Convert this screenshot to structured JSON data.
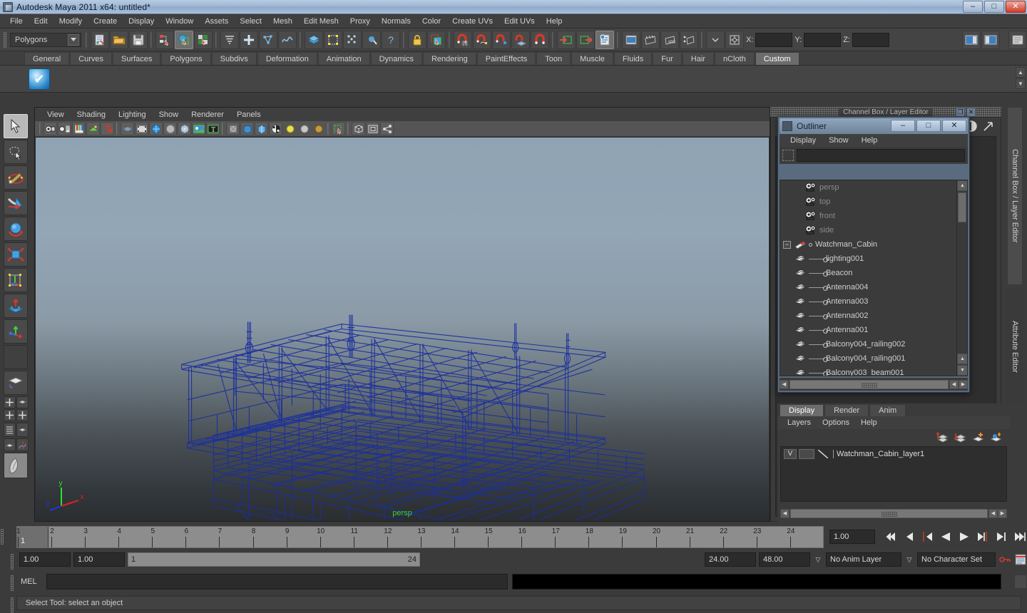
{
  "window": {
    "title": "Autodesk Maya 2011 x64: untitled*",
    "buttons": {
      "minimize": "–",
      "maximize": "□",
      "close": "✕"
    }
  },
  "menubar": {
    "items": [
      "File",
      "Edit",
      "Modify",
      "Create",
      "Display",
      "Window",
      "Assets",
      "Select",
      "Mesh",
      "Edit Mesh",
      "Proxy",
      "Normals",
      "Color",
      "Create UVs",
      "Edit UVs",
      "Help"
    ]
  },
  "statusline": {
    "selection_mode": "Polygons",
    "coords": {
      "x_label": "X:",
      "y_label": "Y:",
      "z_label": "Z:",
      "x_value": "",
      "y_value": "",
      "z_value": ""
    }
  },
  "shelf": {
    "tabs": [
      "General",
      "Curves",
      "Surfaces",
      "Polygons",
      "Subdivs",
      "Deformation",
      "Animation",
      "Dynamics",
      "Rendering",
      "PaintEffects",
      "Toon",
      "Muscle",
      "Fluids",
      "Fur",
      "Hair",
      "nCloth",
      "Custom"
    ],
    "selected_tab": "Custom",
    "items": [
      "check-mark-shelf-icon"
    ]
  },
  "viewport": {
    "menus": [
      "View",
      "Shading",
      "Lighting",
      "Show",
      "Renderer",
      "Panels"
    ],
    "camera_label": "persp",
    "axis": {
      "x": "x",
      "y": "y",
      "z": "z"
    }
  },
  "outliner": {
    "title": "Outliner",
    "window_buttons": {
      "minimize": "–",
      "maximize": "□",
      "close": "✕"
    },
    "menus": [
      "Display",
      "Show",
      "Help"
    ],
    "filter_value": "",
    "items": [
      {
        "label": "persp",
        "type": "camera"
      },
      {
        "label": "top",
        "type": "camera"
      },
      {
        "label": "front",
        "type": "camera"
      },
      {
        "label": "side",
        "type": "camera"
      },
      {
        "label": "Watchman_Cabin",
        "type": "group",
        "expanded": true
      },
      {
        "label": "lighting001",
        "type": "mesh"
      },
      {
        "label": "Beacon",
        "type": "mesh"
      },
      {
        "label": "Antenna004",
        "type": "mesh"
      },
      {
        "label": "Antenna003",
        "type": "mesh"
      },
      {
        "label": "Antenna002",
        "type": "mesh"
      },
      {
        "label": "Antenna001",
        "type": "mesh"
      },
      {
        "label": "Balcony004_railing002",
        "type": "mesh"
      },
      {
        "label": "Balcony004_railing001",
        "type": "mesh"
      },
      {
        "label": "Balcony003_beam001",
        "type": "mesh"
      }
    ]
  },
  "channel_box": {
    "header_title": "Channel Box / Layer Editor",
    "side_tabs": [
      "Channel Box / Layer Editor",
      "Attribute Editor"
    ]
  },
  "layer_editor": {
    "tabs": [
      "Display",
      "Render",
      "Anim"
    ],
    "selected_tab": "Display",
    "menus": [
      "Layers",
      "Options",
      "Help"
    ],
    "layers": [
      {
        "visibility": "V",
        "playback": "",
        "name": "Watchman_Cabin_layer1"
      }
    ]
  },
  "time_slider": {
    "current_frame": "1",
    "start": 1,
    "end": 24,
    "ticks": [
      1,
      2,
      3,
      4,
      5,
      6,
      7,
      8,
      9,
      10,
      11,
      12,
      13,
      14,
      15,
      16,
      17,
      18,
      19,
      20,
      21,
      22,
      23,
      24
    ],
    "current_time_field": "1.00",
    "playback_buttons": [
      "go-to-start",
      "step-back-key",
      "step-back-frame",
      "play-backwards",
      "play-forwards",
      "step-forward-frame",
      "step-forward-key",
      "go-to-end"
    ]
  },
  "range_slider": {
    "anim_start": "1.00",
    "anim_end": "1.00",
    "range_start": "1",
    "range_end": "24",
    "playback_end": "24.00",
    "anim_total_end": "48.00",
    "anim_layer": "No Anim Layer",
    "character_set": "No Character Set"
  },
  "command_line": {
    "label": "MEL",
    "value": "",
    "output": ""
  },
  "help_line": {
    "message": "Select Tool: select an object"
  },
  "colors": {
    "wireframe": "#1b2f9e",
    "accent_green": "#3ecf3e",
    "titlebar_blue": "#9fb8d6",
    "panel_bg": "#3b3b3b"
  }
}
